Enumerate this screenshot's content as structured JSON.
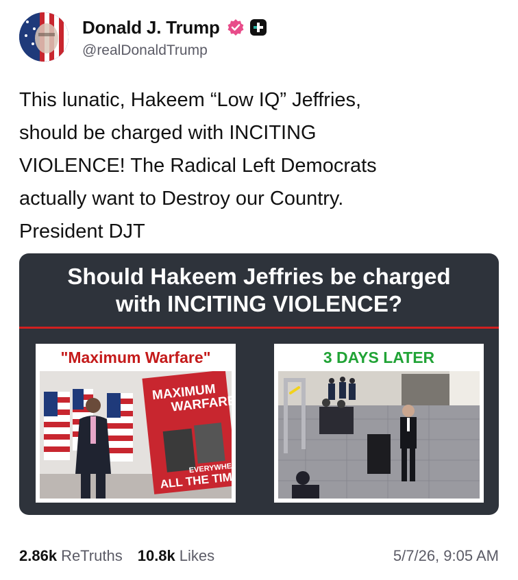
{
  "author": {
    "name": "Donald J. Trump",
    "handle": "@realDonaldTrump",
    "verified_icon": "verified-badge-icon",
    "plus_icon": "plus-badge-icon",
    "accent_color": "#e84c8a"
  },
  "post": {
    "lines": [
      "This lunatic, Hakeem “Low IQ” Jeffries,",
      "should be charged with INCITING",
      "VIOLENCE! The Radical Left Democrats",
      "actually want to Destroy our Country.",
      "President DJT"
    ]
  },
  "card": {
    "title_line1": "Should Hakeem Jeffries be charged",
    "title_line2": "with INCITING VIOLENCE?",
    "left_label": "\"Maximum Warfare\"",
    "right_label": "3 DAYS LATER",
    "left_label_color": "#c41a1a",
    "right_label_color": "#21a336",
    "poster_line1": "MAXIMUM",
    "poster_line2": "WARFARE",
    "poster_line3": "EVERYWHERE",
    "poster_line4": "ALL THE TIME."
  },
  "stats": {
    "retruths_count": "2.86k",
    "retruths_label": "ReTruths",
    "likes_count": "10.8k",
    "likes_label": "Likes",
    "timestamp": "5/7/26, 9:05 AM"
  }
}
